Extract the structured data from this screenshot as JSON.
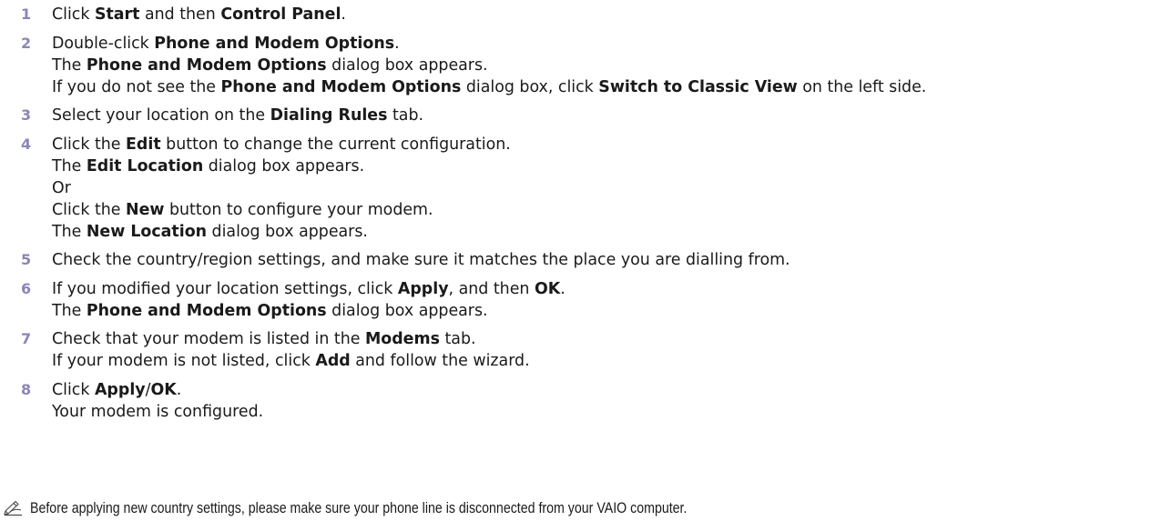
{
  "steps": [
    {
      "num": "1",
      "lines": [
        [
          {
            "t": "Click "
          },
          {
            "t": "Start",
            "b": true
          },
          {
            "t": " and then "
          },
          {
            "t": "Control Panel",
            "b": true
          },
          {
            "t": "."
          }
        ]
      ]
    },
    {
      "num": "2",
      "lines": [
        [
          {
            "t": "Double-click "
          },
          {
            "t": "Phone and Modem Options",
            "b": true
          },
          {
            "t": "."
          }
        ],
        [
          {
            "t": "The "
          },
          {
            "t": "Phone and Modem Options",
            "b": true
          },
          {
            "t": " dialog box appears."
          }
        ],
        [
          {
            "t": "If you do not see the "
          },
          {
            "t": "Phone and Modem Options",
            "b": true
          },
          {
            "t": " dialog box, click "
          },
          {
            "t": "Switch to Classic View",
            "b": true
          },
          {
            "t": " on the left side."
          }
        ]
      ]
    },
    {
      "num": "3",
      "lines": [
        [
          {
            "t": "Select your location on the "
          },
          {
            "t": "Dialing Rules",
            "b": true
          },
          {
            "t": " tab."
          }
        ]
      ]
    },
    {
      "num": "4",
      "lines": [
        [
          {
            "t": "Click the "
          },
          {
            "t": "Edit",
            "b": true
          },
          {
            "t": " button to change the current configuration."
          }
        ],
        [
          {
            "t": "The "
          },
          {
            "t": "Edit Location",
            "b": true
          },
          {
            "t": " dialog box appears."
          }
        ],
        [
          {
            "t": "Or"
          }
        ],
        [
          {
            "t": "Click the "
          },
          {
            "t": "New",
            "b": true
          },
          {
            "t": " button to configure your modem."
          }
        ],
        [
          {
            "t": "The "
          },
          {
            "t": "New Location",
            "b": true
          },
          {
            "t": " dialog box appears."
          }
        ]
      ]
    },
    {
      "num": "5",
      "lines": [
        [
          {
            "t": "Check the country/region settings, and make sure it matches the place you are dialling from."
          }
        ]
      ]
    },
    {
      "num": "6",
      "lines": [
        [
          {
            "t": "If you modified your location settings, click "
          },
          {
            "t": "Apply",
            "b": true
          },
          {
            "t": ", and then "
          },
          {
            "t": "OK",
            "b": true
          },
          {
            "t": "."
          }
        ],
        [
          {
            "t": "The "
          },
          {
            "t": "Phone and Modem Options",
            "b": true
          },
          {
            "t": " dialog box appears."
          }
        ]
      ]
    },
    {
      "num": "7",
      "lines": [
        [
          {
            "t": "Check that your modem is listed in the "
          },
          {
            "t": "Modems",
            "b": true
          },
          {
            "t": " tab."
          }
        ],
        [
          {
            "t": "If your modem is not listed, click "
          },
          {
            "t": "Add",
            "b": true
          },
          {
            "t": " and follow the wizard."
          }
        ]
      ]
    },
    {
      "num": "8",
      "lines": [
        [
          {
            "t": "Click "
          },
          {
            "t": "Apply",
            "b": true
          },
          {
            "t": "/"
          },
          {
            "t": "OK",
            "b": true
          },
          {
            "t": "."
          }
        ],
        [
          {
            "t": "Your modem is configured."
          }
        ]
      ]
    }
  ],
  "note": {
    "icon": "pencil-note-icon",
    "text": "Before applying new country settings, please make sure your phone line is disconnected from your VAIO computer."
  },
  "colors": {
    "step_number": "#8a86b8",
    "text": "#1a1a1a"
  }
}
